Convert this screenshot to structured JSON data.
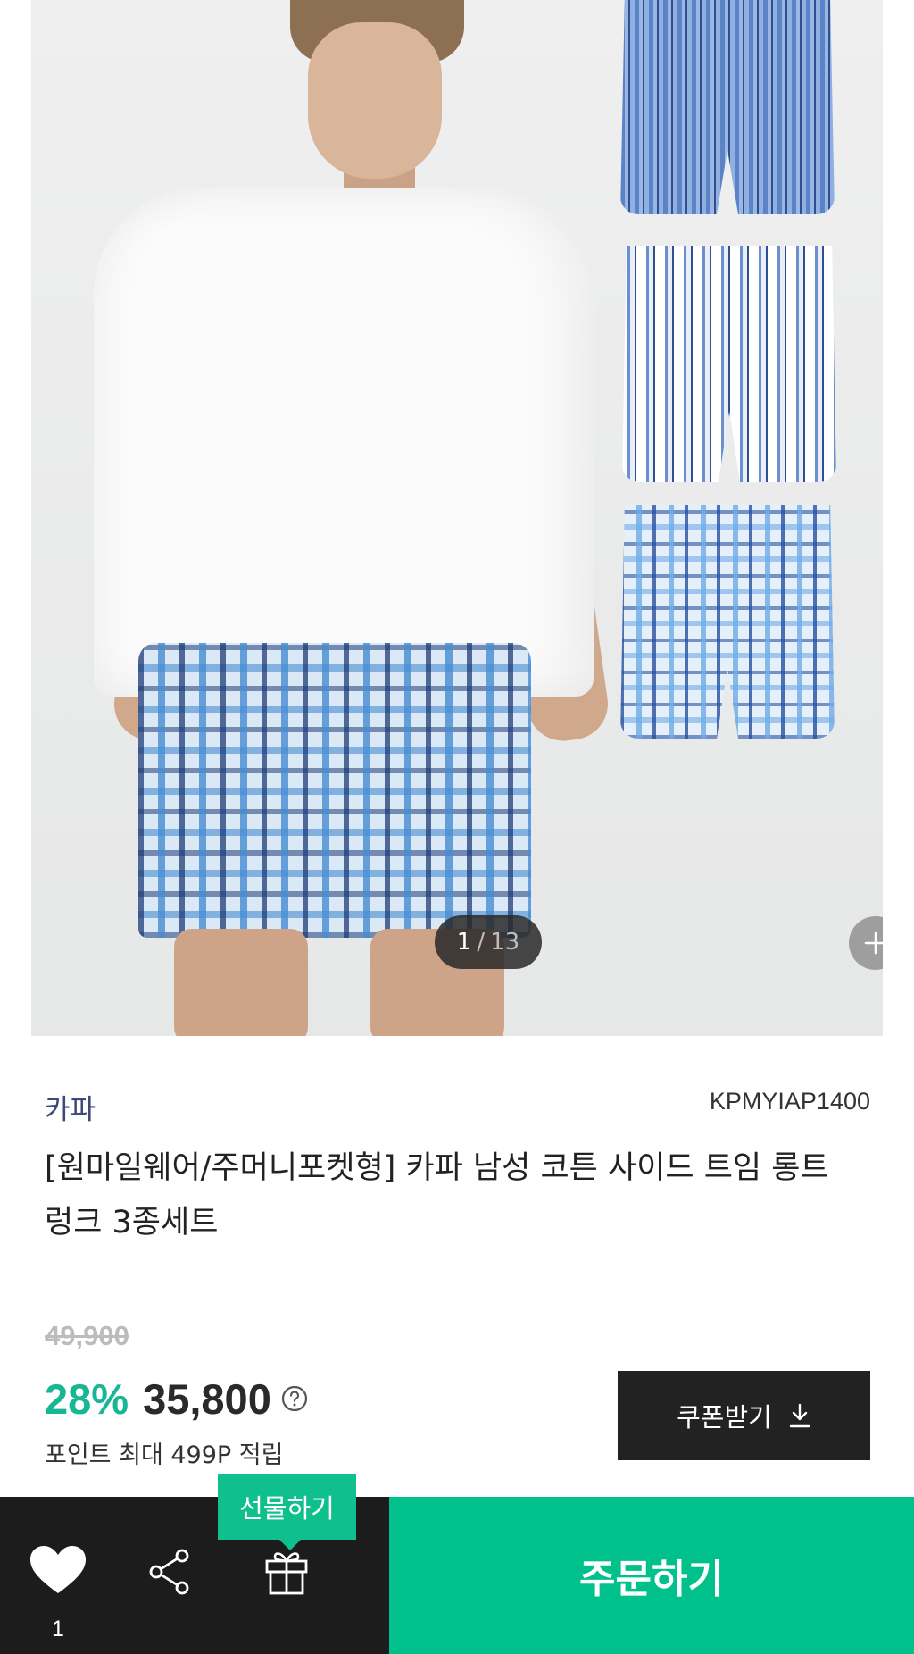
{
  "gallery": {
    "current": "1",
    "separator": "/",
    "total": "13"
  },
  "product": {
    "brand": "카파",
    "code": "KPMYIAP1400",
    "title": "[원마일웨어/주머니포켓형] 카파 남성 코튼 사이드 트임 롱트렁크 3종세트",
    "original_price": "49,900",
    "discount": "28%",
    "sale_price": "35,800",
    "points": "포인트 최대 499P 적립"
  },
  "coupon": {
    "label": "쿠폰받기",
    "icon": "download-icon"
  },
  "bottom_bar": {
    "like_count": "1",
    "like_icon": "heart-icon",
    "share_icon": "share-icon",
    "gift_icon": "gift-icon",
    "gift_tooltip": "선물하기",
    "order_label": "주문하기"
  },
  "colors": {
    "accent": "#00c18b",
    "discount": "#17b694",
    "brand_text": "#3b4a78",
    "dark_bar": "#1c1c1c"
  }
}
